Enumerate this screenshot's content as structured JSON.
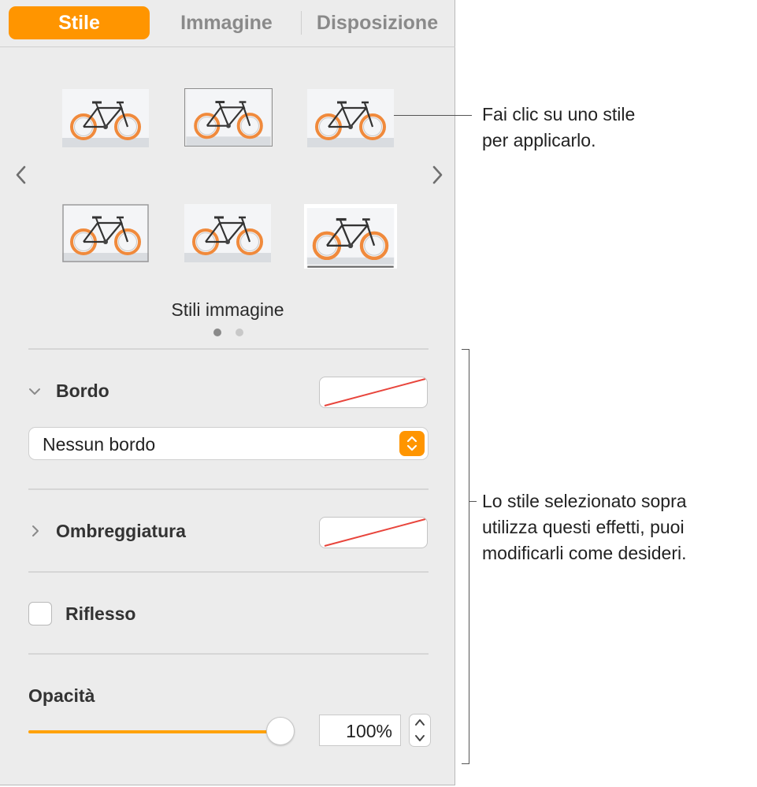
{
  "tabs": {
    "stile": "Stile",
    "immagine": "Immagine",
    "disposizione": "Disposizione"
  },
  "styles": {
    "thumbnails": [
      "bike-style-1",
      "bike-style-2",
      "bike-style-3",
      "bike-style-4",
      "bike-style-5",
      "bike-style-6"
    ],
    "label": "Stili immagine",
    "page_dots": 2,
    "current_page": 1
  },
  "border": {
    "title": "Bordo",
    "popup_value": "Nessun bordo",
    "expanded": true
  },
  "shadow": {
    "title": "Ombreggiatura",
    "expanded": false
  },
  "reflection": {
    "title": "Riflesso",
    "checked": false
  },
  "opacity": {
    "title": "Opacità",
    "value_text": "100%",
    "value": 100
  },
  "callouts": {
    "top_line1": "Fai clic su uno stile",
    "top_line2": "per applicarlo.",
    "bottom_line1": "Lo stile selezionato sopra",
    "bottom_line2": "utilizza questi effetti, puoi",
    "bottom_line3": "modificarli come desideri."
  },
  "colors": {
    "accent": "#ff9500",
    "panel_bg": "#ececec",
    "no_color_line": "#e8453c"
  },
  "icons": [
    "chevron-left-icon",
    "chevron-right-icon",
    "disclosure-down-icon",
    "disclosure-right-icon",
    "popup-stepper-icon",
    "stepper-up-icon",
    "stepper-down-icon"
  ]
}
